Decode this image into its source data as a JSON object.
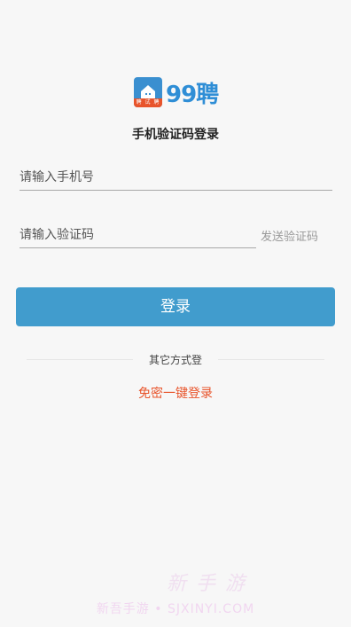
{
  "logo": {
    "icon_ribbon_text": "聘 试 聘",
    "text": "99聘"
  },
  "title": "手机验证码登录",
  "phone": {
    "placeholder": "请输入手机号",
    "value": ""
  },
  "code": {
    "placeholder": "请输入验证码",
    "value": "",
    "send_label": "发送验证码"
  },
  "login_button": "登录",
  "other_methods_label": "其它方式登",
  "passwordless_link": "免密一键登录",
  "watermark": {
    "logo_text": "新 手 游",
    "text": "新吾手游 • SJXINYI.COM"
  },
  "colors": {
    "accent": "#419ccd",
    "link": "#e8542b",
    "brand_blue": "#2f8ed6"
  }
}
